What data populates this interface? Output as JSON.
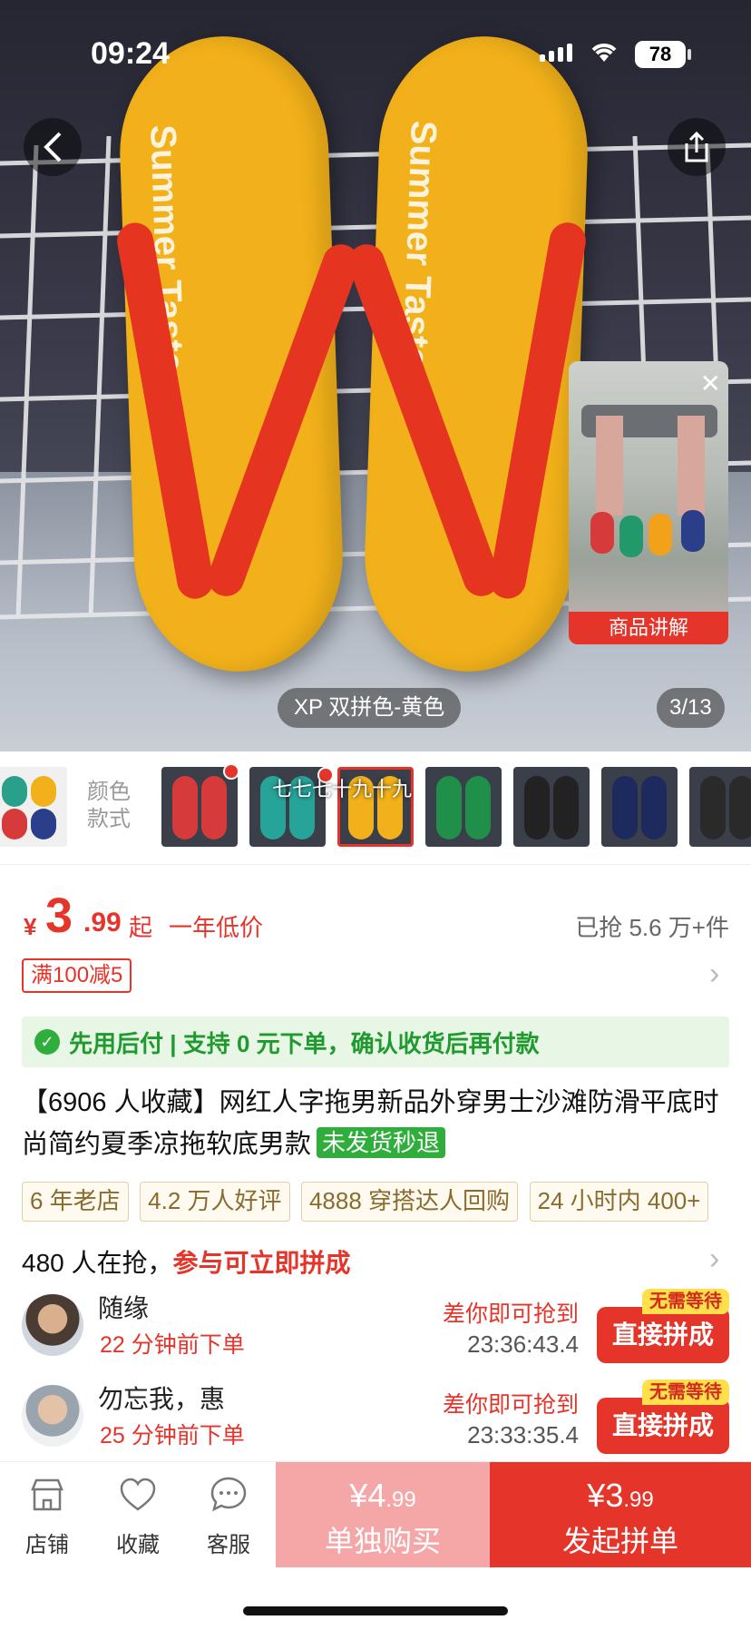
{
  "status_bar": {
    "time": "09:24",
    "battery": "78"
  },
  "hero": {
    "sole_text": "Summer Taste",
    "variant_label": "XP 双拼色-黄色",
    "counter": "3/13",
    "video_label": "商品讲解"
  },
  "thumbs": {
    "color_label": "颜色款式",
    "caption": "七七七十九十九"
  },
  "price": {
    "currency": "¥",
    "integer": "3",
    "decimal": ".99",
    "suffix": "起",
    "low_tag": "一年低价",
    "sold": "已抢 5.6 万+件"
  },
  "coupon": "满100减5",
  "pay_later": "先用后付 | 支持 0 元下单，确认收货后再付款",
  "title": {
    "text": "【6906 人收藏】网红人字拖男新品外穿男士沙滩防滑平底时尚简约夏季凉拖软底男款",
    "badge": "未发货秒退"
  },
  "tags": [
    "6 年老店",
    "4.2 万人好评",
    "4888 穿搭达人回购",
    "24 小时内 400+"
  ],
  "group": {
    "count_text": "480 人在抢，",
    "highlight": "参与可立即拼成"
  },
  "buyers": [
    {
      "name": "随缘",
      "ordered": "22 分钟前下单",
      "countdown_label": "差你即可抢到",
      "countdown": "23:36:43.4",
      "tag": "无需等待",
      "button": "直接拼成"
    },
    {
      "name": "勿忘我，惠",
      "ordered": "25 分钟前下单",
      "countdown_label": "差你即可抢到",
      "countdown": "23:33:35.4",
      "tag": "无需等待",
      "button": "直接拼成"
    }
  ],
  "bottom_bar": {
    "shop": "店铺",
    "favorite": "收藏",
    "service": "客服",
    "solo_price_currency": "¥",
    "solo_price_int": "4",
    "solo_price_dec": ".99",
    "solo_label": "单独购买",
    "group_price_currency": "¥",
    "group_price_int": "3",
    "group_price_dec": ".99",
    "group_label": "发起拼单"
  },
  "colors": {
    "accent": "#e5342a",
    "green": "#2fae3c",
    "sole": "#f2b11a",
    "strap": "#e5341f"
  }
}
